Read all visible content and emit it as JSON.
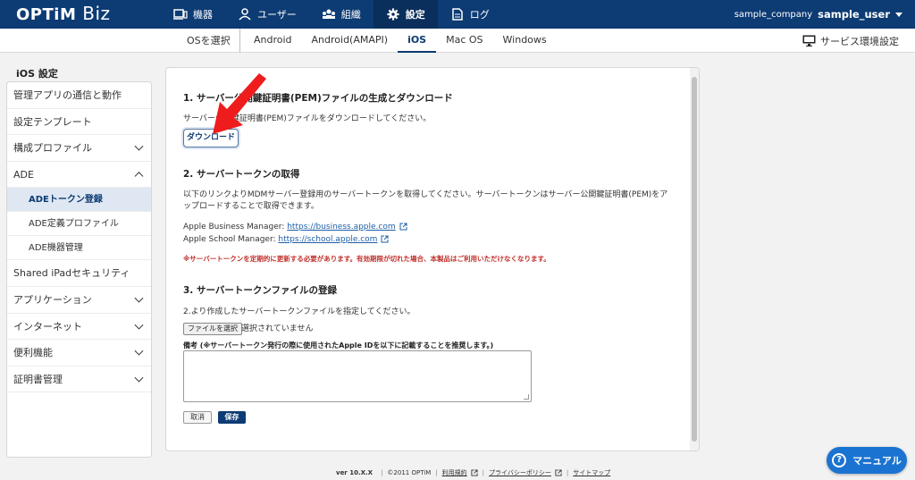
{
  "header": {
    "logo_main": "OPTiM",
    "logo_sub": "Biz",
    "nav": [
      {
        "label": "機器",
        "icon": "device-icon"
      },
      {
        "label": "ユーザー",
        "icon": "user-icon"
      },
      {
        "label": "組織",
        "icon": "organization-icon"
      },
      {
        "label": "設定",
        "icon": "gear-icon"
      },
      {
        "label": "ログ",
        "icon": "log-icon"
      }
    ],
    "company": "sample_company",
    "user": "sample_user"
  },
  "subnav": {
    "os_label": "OSを選択",
    "tabs": [
      "Android",
      "Android(AMAPI)",
      "iOS",
      "Mac OS",
      "Windows"
    ],
    "active_tab": "iOS",
    "env_label": "サービス環境設定"
  },
  "sidebar": {
    "title": "iOS 設定",
    "items": [
      {
        "label": "管理アプリの通信と動作"
      },
      {
        "label": "設定テンプレート"
      },
      {
        "label": "構成プロファイル"
      },
      {
        "label": "ADE"
      },
      {
        "label": "ADEトークン登録"
      },
      {
        "label": "ADE定義プロファイル"
      },
      {
        "label": "ADE機器管理"
      },
      {
        "label": "Shared iPadセキュリティ"
      },
      {
        "label": "アプリケーション"
      },
      {
        "label": "インターネット"
      },
      {
        "label": "便利機能"
      },
      {
        "label": "証明書管理"
      }
    ]
  },
  "main": {
    "section1": {
      "title": "1. サーバー公開鍵証明書(PEM)ファイルの生成とダウンロード",
      "text": "サーバー公開鍵証明書(PEM)ファイルをダウンロードしてください。",
      "button": "ダウンロード"
    },
    "section2": {
      "title": "2. サーバートークンの取得",
      "text": "以下のリンクよりMDMサーバー登録用のサーバートークンを取得してください。サーバートークンはサーバー公開鍵証明書(PEM)をアップロードすることで取得できます。",
      "abm_label": "Apple Business Manager: ",
      "abm_link": "https://business.apple.com",
      "asm_label": "Apple School Manager: ",
      "asm_link": "https://school.apple.com",
      "warning": "※サーバートークンを定期的に更新する必要があります。有効期限が切れた場合、本製品はご利用いただけなくなります。"
    },
    "section3": {
      "title": "3. サーバートークンファイルの登録",
      "text": "2.より作成したサーバートークンファイルを指定してください。",
      "file_button": "ファイルを選択",
      "file_status": "選択されていません",
      "note_label": "備考 (※サーバートークン発行の際に使用されたApple IDを以下に記載することを推奨します。)",
      "note_value": "",
      "cancel": "取消",
      "save": "保存"
    }
  },
  "footer": {
    "version": "ver 10.X.X",
    "copyright": "©2011 OPTiM",
    "terms": "利用規約",
    "privacy": "プライバシーポリシー",
    "sitemap": "サイトマップ"
  },
  "manual_label": "マニュアル",
  "colors": {
    "header_bg": "#0d3b73",
    "accent": "#1b73d1",
    "warning": "#c0302b",
    "arrow": "#ee1c1c"
  }
}
